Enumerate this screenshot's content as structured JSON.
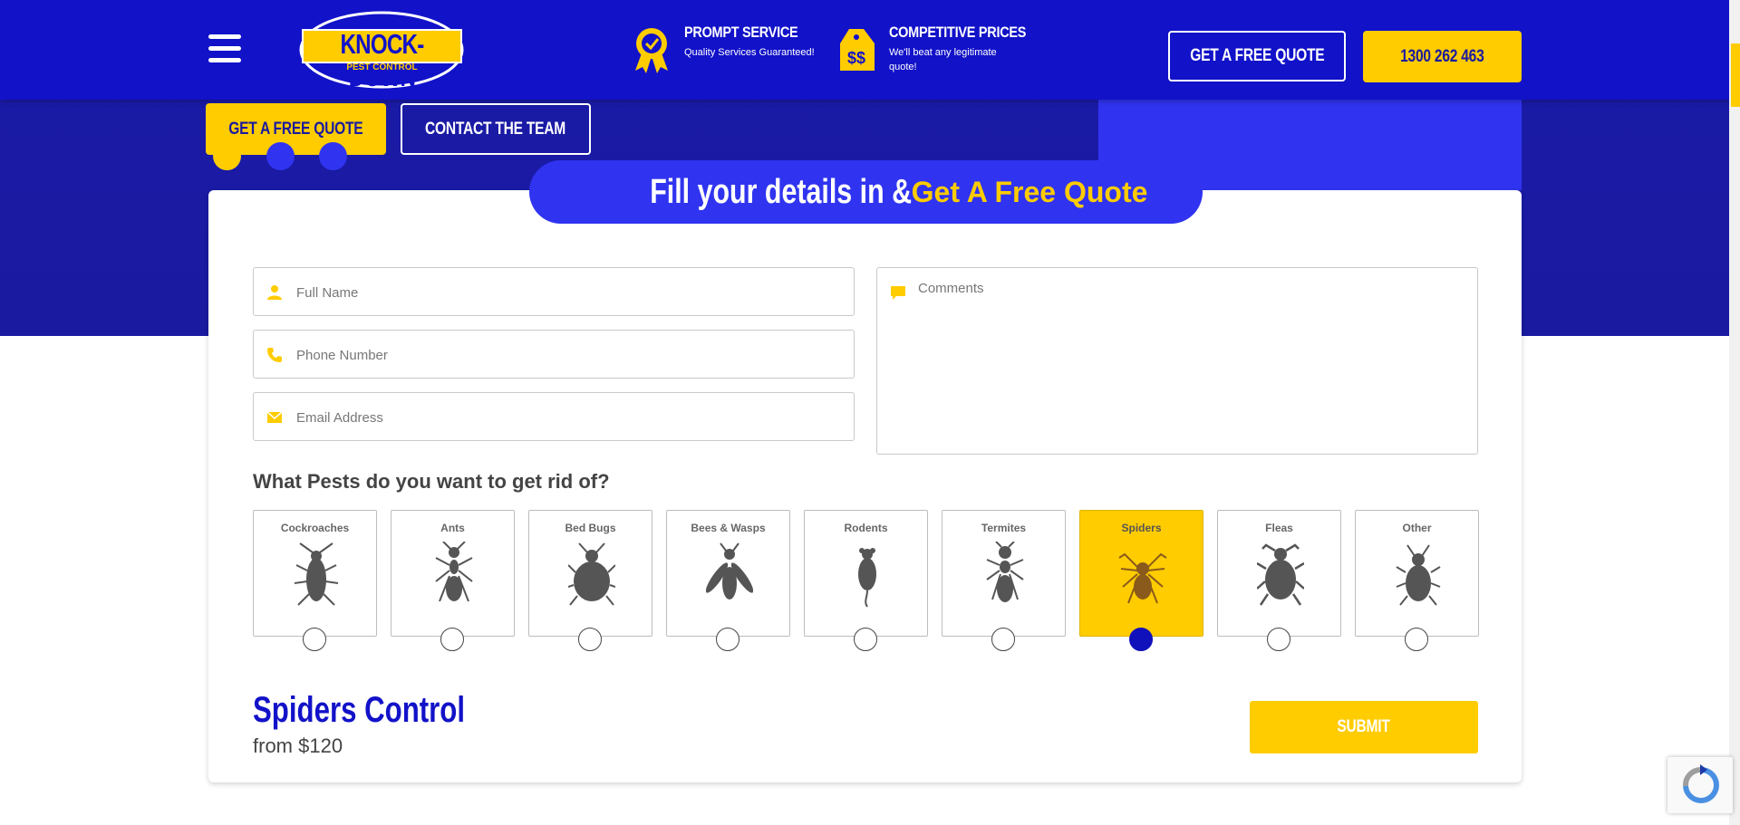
{
  "header": {
    "logo_main": "KNOCK-DOWN",
    "logo_sub": "PEST CONTROL",
    "features": [
      {
        "title": "PROMPT SERVICE",
        "desc": "Quality Services Guaranteed!",
        "icon": "award-ribbon-icon"
      },
      {
        "title": "COMPETITIVE PRICES",
        "desc": "We'll beat any legitimate quote!",
        "icon": "price-tag-icon"
      }
    ],
    "quote_btn": "GET A FREE QUOTE",
    "phone_btn": "1300 262 463"
  },
  "hero": {
    "quote_btn": "GET A FREE QUOTE",
    "contact_btn": "CONTACT THE TEAM"
  },
  "form": {
    "title_part1": "Fill your details in &",
    "title_part2": "Get A Free Quote",
    "full_name_placeholder": "Full Name",
    "phone_placeholder": "Phone Number",
    "email_placeholder": "Email Address",
    "comments_placeholder": "Comments",
    "question": "What Pests do you want to get rid of?",
    "pests": [
      {
        "label": "Cockroaches",
        "selected": false
      },
      {
        "label": "Ants",
        "selected": false
      },
      {
        "label": "Bed Bugs",
        "selected": false
      },
      {
        "label": "Bees & Wasps",
        "selected": false
      },
      {
        "label": "Rodents",
        "selected": false
      },
      {
        "label": "Termites",
        "selected": false
      },
      {
        "label": "Spiders",
        "selected": true
      },
      {
        "label": "Fleas",
        "selected": false
      },
      {
        "label": "Other",
        "selected": false
      }
    ],
    "result_title": "Spiders Control",
    "result_price": "from $120",
    "submit_label": "SUBMIT"
  },
  "colors": {
    "primary_blue": "#1212c9",
    "accent_yellow": "#ffcc00",
    "title_pill": "#3034f0"
  }
}
